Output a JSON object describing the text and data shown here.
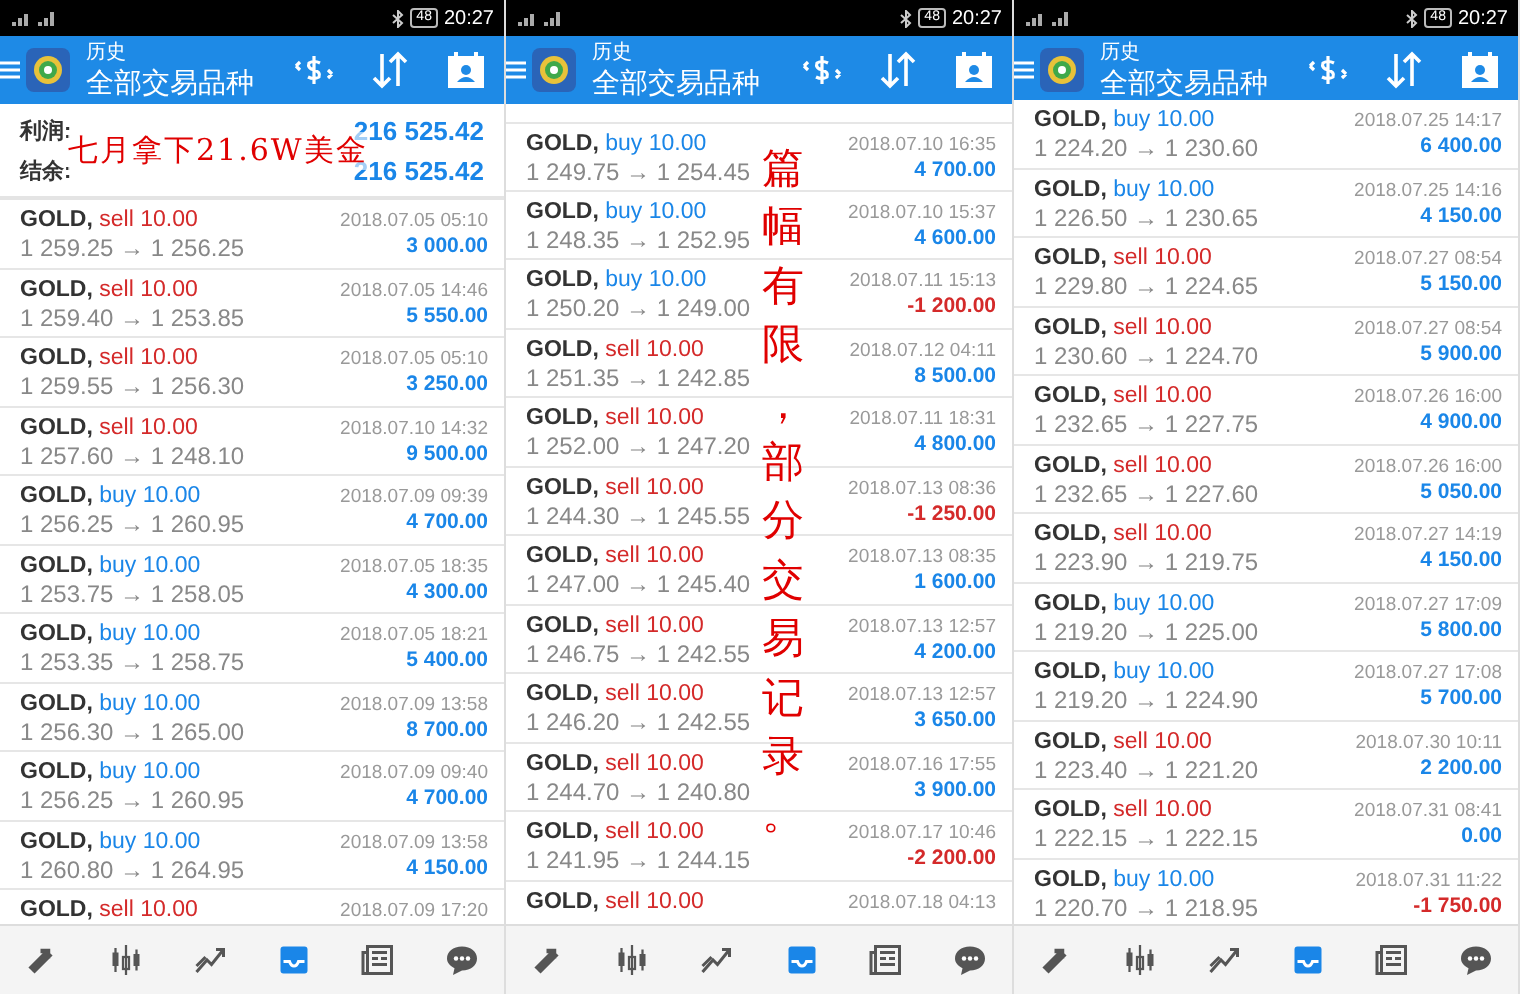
{
  "panels": [
    {
      "status_bar": {
        "battery": "48",
        "time": "20:27"
      },
      "header": {
        "title": "历史",
        "subtitle": "全部交易品种"
      },
      "summary": [
        {
          "label": "利润:",
          "value": "216 525.42"
        },
        {
          "label": "结余:",
          "value": "216 525.42"
        }
      ],
      "annotation": {
        "kind": "horizontal",
        "text": "七月拿下21.6W美金"
      },
      "trades": [
        {
          "symbol": "GOLD,",
          "side": "sell",
          "volume": "10.00",
          "prices": "1 259.25 → 1 256.25",
          "time": "2018.07.05 05:10",
          "profit": "3 000.00",
          "loss": false
        },
        {
          "symbol": "GOLD,",
          "side": "sell",
          "volume": "10.00",
          "prices": "1 259.40 → 1 253.85",
          "time": "2018.07.05 14:46",
          "profit": "5 550.00",
          "loss": false
        },
        {
          "symbol": "GOLD,",
          "side": "sell",
          "volume": "10.00",
          "prices": "1 259.55 → 1 256.30",
          "time": "2018.07.05 05:10",
          "profit": "3 250.00",
          "loss": false
        },
        {
          "symbol": "GOLD,",
          "side": "sell",
          "volume": "10.00",
          "prices": "1 257.60 → 1 248.10",
          "time": "2018.07.10 14:32",
          "profit": "9 500.00",
          "loss": false
        },
        {
          "symbol": "GOLD,",
          "side": "buy",
          "volume": "10.00",
          "prices": "1 256.25 → 1 260.95",
          "time": "2018.07.09 09:39",
          "profit": "4 700.00",
          "loss": false
        },
        {
          "symbol": "GOLD,",
          "side": "buy",
          "volume": "10.00",
          "prices": "1 253.75 → 1 258.05",
          "time": "2018.07.05 18:35",
          "profit": "4 300.00",
          "loss": false
        },
        {
          "symbol": "GOLD,",
          "side": "buy",
          "volume": "10.00",
          "prices": "1 253.35 → 1 258.75",
          "time": "2018.07.05 18:21",
          "profit": "5 400.00",
          "loss": false
        },
        {
          "symbol": "GOLD,",
          "side": "buy",
          "volume": "10.00",
          "prices": "1 256.30 → 1 265.00",
          "time": "2018.07.09 13:58",
          "profit": "8 700.00",
          "loss": false
        },
        {
          "symbol": "GOLD,",
          "side": "buy",
          "volume": "10.00",
          "prices": "1 256.25 → 1 260.95",
          "time": "2018.07.09 09:40",
          "profit": "4 700.00",
          "loss": false
        },
        {
          "symbol": "GOLD,",
          "side": "buy",
          "volume": "10.00",
          "prices": "1 260.80 → 1 264.95",
          "time": "2018.07.09 13:58",
          "profit": "4 150.00",
          "loss": false
        },
        {
          "symbol": "GOLD,",
          "side": "sell",
          "volume": "10.00",
          "time": "2018.07.09 17:20"
        }
      ],
      "nav": [
        {
          "kind": "trade",
          "selected": false
        },
        {
          "kind": "quotes",
          "selected": false
        },
        {
          "kind": "chart",
          "selected": false
        },
        {
          "kind": "history",
          "selected": true
        },
        {
          "kind": "news",
          "selected": false
        },
        {
          "kind": "chat",
          "selected": false
        }
      ]
    },
    {
      "status_bar": {
        "battery": "48",
        "time": "20:27"
      },
      "header": {
        "title": "历史",
        "subtitle": "全部交易品种"
      },
      "annotation": {
        "kind": "vertical",
        "text": "篇幅有限，部分交易记录。"
      },
      "trades": [
        {
          "symbol": "GOLD,",
          "side": "buy",
          "volume": "10.00",
          "prices": "1 249.75 → 1 254.45",
          "time": "2018.07.10 16:35",
          "profit": "4 700.00",
          "loss": false
        },
        {
          "symbol": "GOLD,",
          "side": "buy",
          "volume": "10.00",
          "prices": "1 248.35 → 1 252.95",
          "time": "2018.07.10 15:37",
          "profit": "4 600.00",
          "loss": false
        },
        {
          "symbol": "GOLD,",
          "side": "buy",
          "volume": "10.00",
          "prices": "1 250.20 → 1 249.00",
          "time": "2018.07.11 15:13",
          "profit": "-1 200.00",
          "loss": true
        },
        {
          "symbol": "GOLD,",
          "side": "sell",
          "volume": "10.00",
          "prices": "1 251.35 → 1 242.85",
          "time": "2018.07.12 04:11",
          "profit": "8 500.00",
          "loss": false
        },
        {
          "symbol": "GOLD,",
          "side": "sell",
          "volume": "10.00",
          "prices": "1 252.00 → 1 247.20",
          "time": "2018.07.11 18:31",
          "profit": "4 800.00",
          "loss": false
        },
        {
          "symbol": "GOLD,",
          "side": "sell",
          "volume": "10.00",
          "prices": "1 244.30 → 1 245.55",
          "time": "2018.07.13 08:36",
          "profit": "-1 250.00",
          "loss": true
        },
        {
          "symbol": "GOLD,",
          "side": "sell",
          "volume": "10.00",
          "prices": "1 247.00 → 1 245.40",
          "time": "2018.07.13 08:35",
          "profit": "1 600.00",
          "loss": false
        },
        {
          "symbol": "GOLD,",
          "side": "sell",
          "volume": "10.00",
          "prices": "1 246.75 → 1 242.55",
          "time": "2018.07.13 12:57",
          "profit": "4 200.00",
          "loss": false
        },
        {
          "symbol": "GOLD,",
          "side": "sell",
          "volume": "10.00",
          "prices": "1 246.20 → 1 242.55",
          "time": "2018.07.13 12:57",
          "profit": "3 650.00",
          "loss": false
        },
        {
          "symbol": "GOLD,",
          "side": "sell",
          "volume": "10.00",
          "prices": "1 244.70 → 1 240.80",
          "time": "2018.07.16 17:55",
          "profit": "3 900.00",
          "loss": false
        },
        {
          "symbol": "GOLD,",
          "side": "sell",
          "volume": "10.00",
          "prices": "1 241.95 → 1 244.15",
          "time": "2018.07.17 10:46",
          "profit": "-2 200.00",
          "loss": true
        },
        {
          "symbol": "GOLD,",
          "side": "sell",
          "volume": "10.00",
          "time": "2018.07.18 04:13"
        }
      ],
      "nav": [
        {
          "kind": "trade",
          "selected": false
        },
        {
          "kind": "quotes",
          "selected": false
        },
        {
          "kind": "chart",
          "selected": false
        },
        {
          "kind": "history",
          "selected": true
        },
        {
          "kind": "news",
          "selected": false
        },
        {
          "kind": "chat",
          "selected": false
        }
      ]
    },
    {
      "status_bar": {
        "battery": "48",
        "time": "20:27"
      },
      "header": {
        "title": "历史",
        "subtitle": "全部交易品种"
      },
      "trades": [
        {
          "symbol": "GOLD,",
          "side": "buy",
          "volume": "10.00",
          "prices": "1 224.20 → 1 230.60",
          "time": "2018.07.25 14:17",
          "profit": "6 400.00",
          "loss": false
        },
        {
          "symbol": "GOLD,",
          "side": "buy",
          "volume": "10.00",
          "prices": "1 226.50 → 1 230.65",
          "time": "2018.07.25 14:16",
          "profit": "4 150.00",
          "loss": false
        },
        {
          "symbol": "GOLD,",
          "side": "sell",
          "volume": "10.00",
          "prices": "1 229.80 → 1 224.65",
          "time": "2018.07.27 08:54",
          "profit": "5 150.00",
          "loss": false
        },
        {
          "symbol": "GOLD,",
          "side": "sell",
          "volume": "10.00",
          "prices": "1 230.60 → 1 224.70",
          "time": "2018.07.27 08:54",
          "profit": "5 900.00",
          "loss": false
        },
        {
          "symbol": "GOLD,",
          "side": "sell",
          "volume": "10.00",
          "prices": "1 232.65 → 1 227.75",
          "time": "2018.07.26 16:00",
          "profit": "4 900.00",
          "loss": false
        },
        {
          "symbol": "GOLD,",
          "side": "sell",
          "volume": "10.00",
          "prices": "1 232.65 → 1 227.60",
          "time": "2018.07.26 16:00",
          "profit": "5 050.00",
          "loss": false
        },
        {
          "symbol": "GOLD,",
          "side": "sell",
          "volume": "10.00",
          "prices": "1 223.90 → 1 219.75",
          "time": "2018.07.27 14:19",
          "profit": "4 150.00",
          "loss": false
        },
        {
          "symbol": "GOLD,",
          "side": "buy",
          "volume": "10.00",
          "prices": "1 219.20 → 1 225.00",
          "time": "2018.07.27 17:09",
          "profit": "5 800.00",
          "loss": false
        },
        {
          "symbol": "GOLD,",
          "side": "buy",
          "volume": "10.00",
          "prices": "1 219.20 → 1 224.90",
          "time": "2018.07.27 17:08",
          "profit": "5 700.00",
          "loss": false
        },
        {
          "symbol": "GOLD,",
          "side": "sell",
          "volume": "10.00",
          "prices": "1 223.40 → 1 221.20",
          "time": "2018.07.30 10:11",
          "profit": "2 200.00",
          "loss": false
        },
        {
          "symbol": "GOLD,",
          "side": "sell",
          "volume": "10.00",
          "prices": "1 222.15 → 1 222.15",
          "time": "2018.07.31 08:41",
          "profit": "0.00",
          "loss": false
        },
        {
          "symbol": "GOLD,",
          "side": "buy",
          "volume": "10.00",
          "prices": "1 220.70 → 1 218.95",
          "time": "2018.07.31 11:22",
          "profit": "-1 750.00",
          "loss": true
        }
      ],
      "nav": [
        {
          "kind": "trade",
          "selected": false
        },
        {
          "kind": "quotes",
          "selected": false
        },
        {
          "kind": "chart",
          "selected": false
        },
        {
          "kind": "history",
          "selected": true
        },
        {
          "kind": "news",
          "selected": false
        },
        {
          "kind": "chat",
          "selected": false
        }
      ]
    }
  ]
}
